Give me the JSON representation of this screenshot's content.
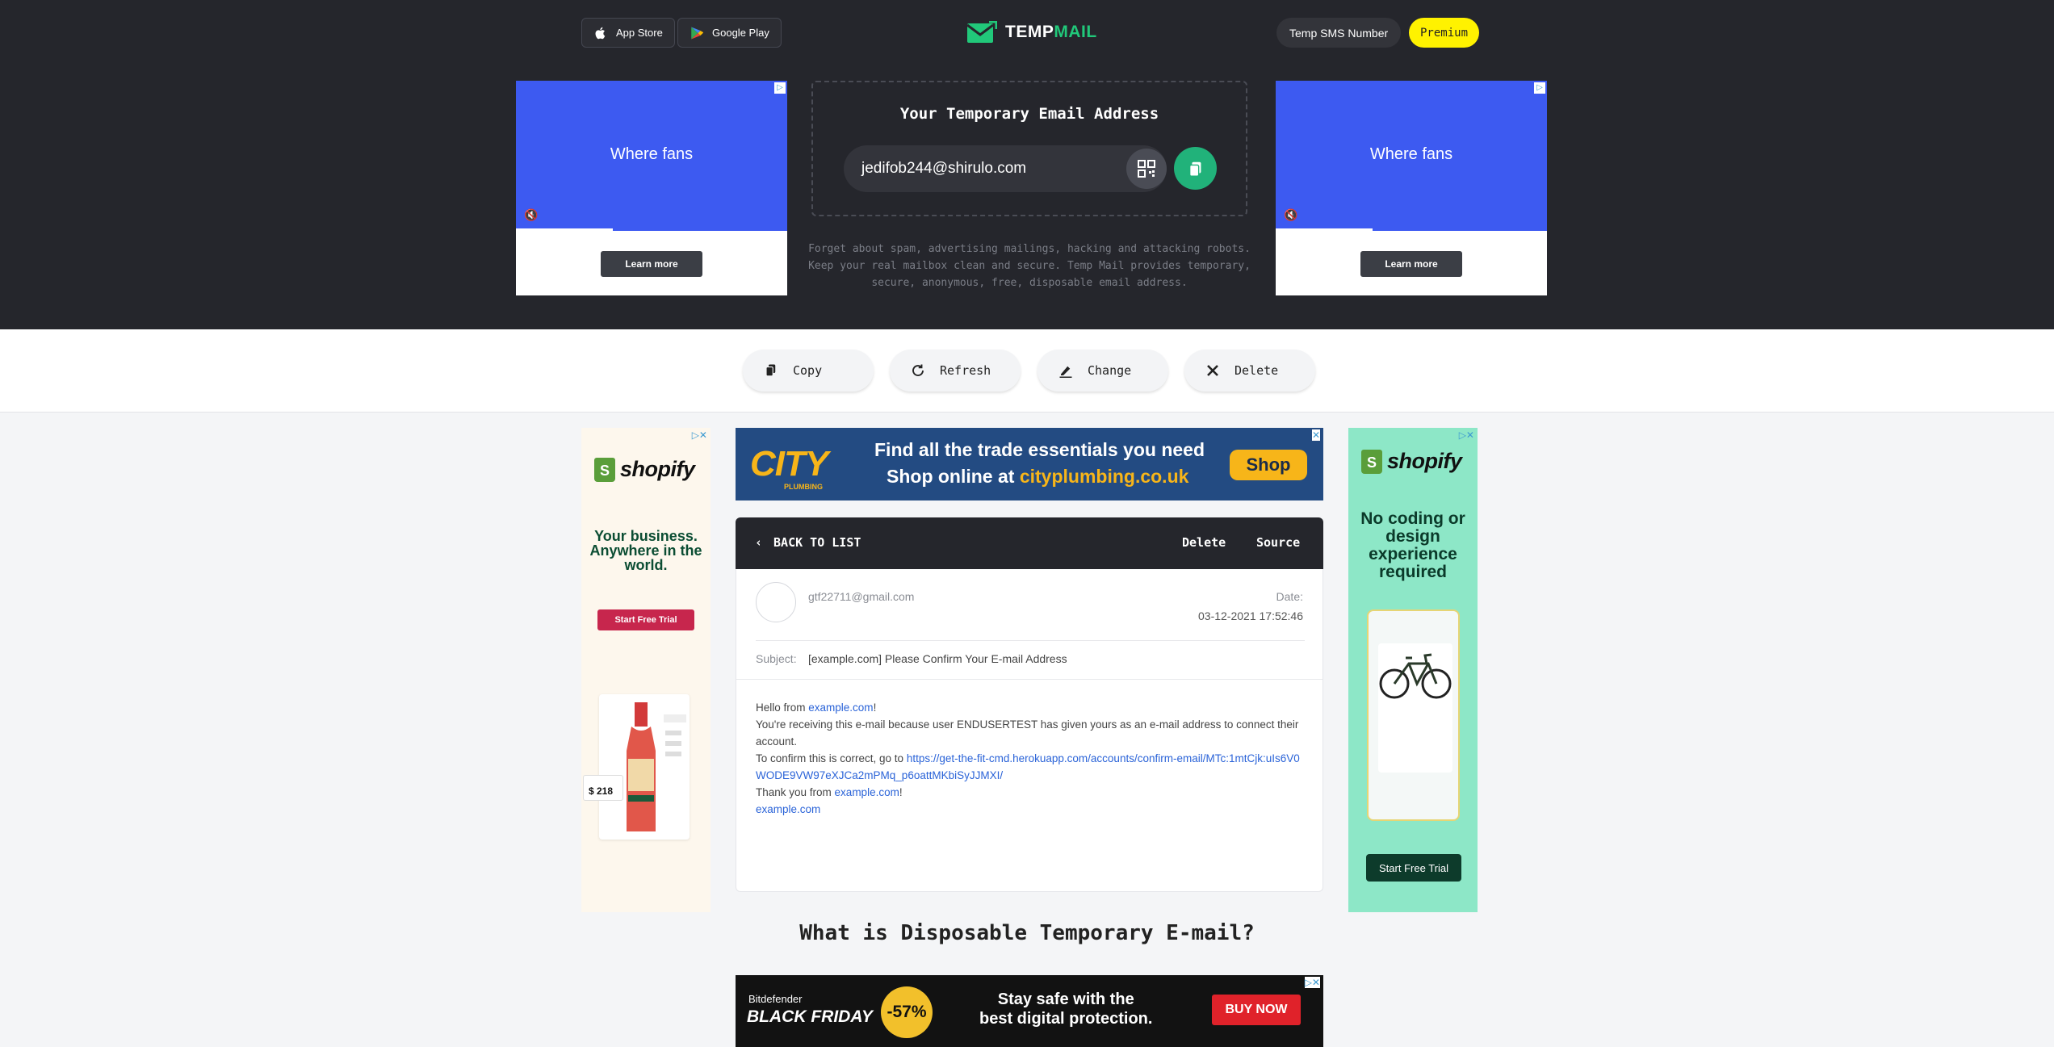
{
  "header": {
    "app_store": "App Store",
    "google_play": "Google Play",
    "logo_prefix": "TEMP",
    "logo_suffix": "MAIL",
    "sms_button": "Temp SMS Number",
    "premium_button": "Premium"
  },
  "email": {
    "title": "Your Temporary Email Address",
    "address": "jedifob244@shirulo.com",
    "description": "Forget about spam, advertising mailings, hacking and attacking robots. Keep your real mailbox clean and secure. Temp Mail provides temporary, secure, anonymous, free, disposable email address."
  },
  "side_ads": {
    "left_text": "Where fans",
    "right_text": "Where fans",
    "learn_more": "Learn more"
  },
  "actions": {
    "copy": "Copy",
    "refresh": "Refresh",
    "change": "Change",
    "delete": "Delete"
  },
  "city_ad": {
    "logo": "CITY",
    "logo_sub": "PLUMBING",
    "line1": "Find all the trade essentials you need",
    "line2_prefix": "Shop online at ",
    "line2_site": "cityplumbing.co.uk",
    "cta": "Shop"
  },
  "shopify_left": {
    "brand": "shopify",
    "tagline": "Your business. Anywhere in the world.",
    "cta": "Start Free Trial",
    "price": "$ 218"
  },
  "shopify_right": {
    "brand": "shopify",
    "tagline": "No coding or design experience required",
    "cta": "Start Free Trial"
  },
  "message": {
    "back": "BACK TO LIST",
    "delete": "Delete",
    "source": "Source",
    "from": "gtf22711@gmail.com",
    "date_label": "Date:",
    "date_value": "03-12-2021 17:52:46",
    "subject_label": "Subject:",
    "subject": "[example.com] Please Confirm Your E-mail Address",
    "body": {
      "hello_prefix": "Hello from ",
      "site": "example.com",
      "hello_suffix": "!",
      "line2": "You're receiving this e-mail because user ENDUSERTEST has given yours as an e-mail address to connect their account.",
      "confirm_prefix": "To confirm this is correct, go to ",
      "confirm_link": "https://get-the-fit-cmd.herokuapp.com/accounts/confirm-email/MTc:1mtCjk:uIs6V0WODE9VW97eXJCa2mPMq_p6oattMKbiSyJJMXI/",
      "thanks_prefix": "Thank you from ",
      "thanks_site": "example.com",
      "thanks_suffix": "!",
      "footer_site": "example.com"
    }
  },
  "section_title": "What is Disposable Temporary E-mail?",
  "bitdefender_ad": {
    "brand": "Bitdefender",
    "event": "BLACK FRIDAY",
    "discount": "-57%",
    "text_line1": "Stay safe with the",
    "text_line2": "best digital protection.",
    "cta": "BUY NOW"
  },
  "colors": {
    "header_bg": "#25262c",
    "accent_green": "#21c87a",
    "premium_yellow": "#fff200",
    "link_blue": "#2a63d8"
  }
}
